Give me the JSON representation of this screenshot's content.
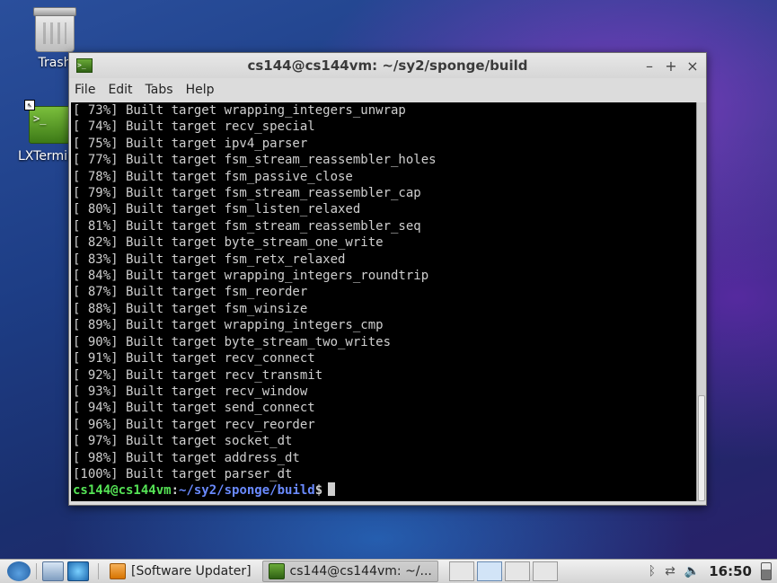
{
  "desktop": {
    "icons": [
      {
        "label": "Trash"
      },
      {
        "label": "LXTerminal"
      }
    ]
  },
  "window": {
    "title": "cs144@cs144vm: ~/sy2/sponge/build",
    "controls": {
      "minimize": "–",
      "maximize": "+",
      "close": "×"
    },
    "menu": [
      "File",
      "Edit",
      "Tabs",
      "Help"
    ]
  },
  "terminal": {
    "lines": [
      "[ 73%] Built target wrapping_integers_unwrap",
      "[ 74%] Built target recv_special",
      "[ 75%] Built target ipv4_parser",
      "[ 77%] Built target fsm_stream_reassembler_holes",
      "[ 78%] Built target fsm_passive_close",
      "[ 79%] Built target fsm_stream_reassembler_cap",
      "[ 80%] Built target fsm_listen_relaxed",
      "[ 81%] Built target fsm_stream_reassembler_seq",
      "[ 82%] Built target byte_stream_one_write",
      "[ 83%] Built target fsm_retx_relaxed",
      "[ 84%] Built target wrapping_integers_roundtrip",
      "[ 87%] Built target fsm_reorder",
      "[ 88%] Built target fsm_winsize",
      "[ 89%] Built target wrapping_integers_cmp",
      "[ 90%] Built target byte_stream_two_writes",
      "[ 91%] Built target recv_connect",
      "[ 92%] Built target recv_transmit",
      "[ 93%] Built target recv_window",
      "[ 94%] Built target send_connect",
      "[ 96%] Built target recv_reorder",
      "[ 97%] Built target socket_dt",
      "[ 98%] Built target address_dt",
      "[100%] Built target parser_dt"
    ],
    "prompt": {
      "user_host": "cs144@cs144vm",
      "separator": ":",
      "path": "~/sy2/sponge/build",
      "symbol": "$"
    },
    "colors": {
      "user": "#55e455",
      "path": "#6a8aff",
      "text": "#cfcfcf"
    }
  },
  "taskbar": {
    "tasks": [
      {
        "label": "[Software Updater]",
        "icon": "updater-icon"
      },
      {
        "label": "cs144@cs144vm: ~/...",
        "icon": "terminal-icon"
      }
    ],
    "clock": "16:50"
  }
}
